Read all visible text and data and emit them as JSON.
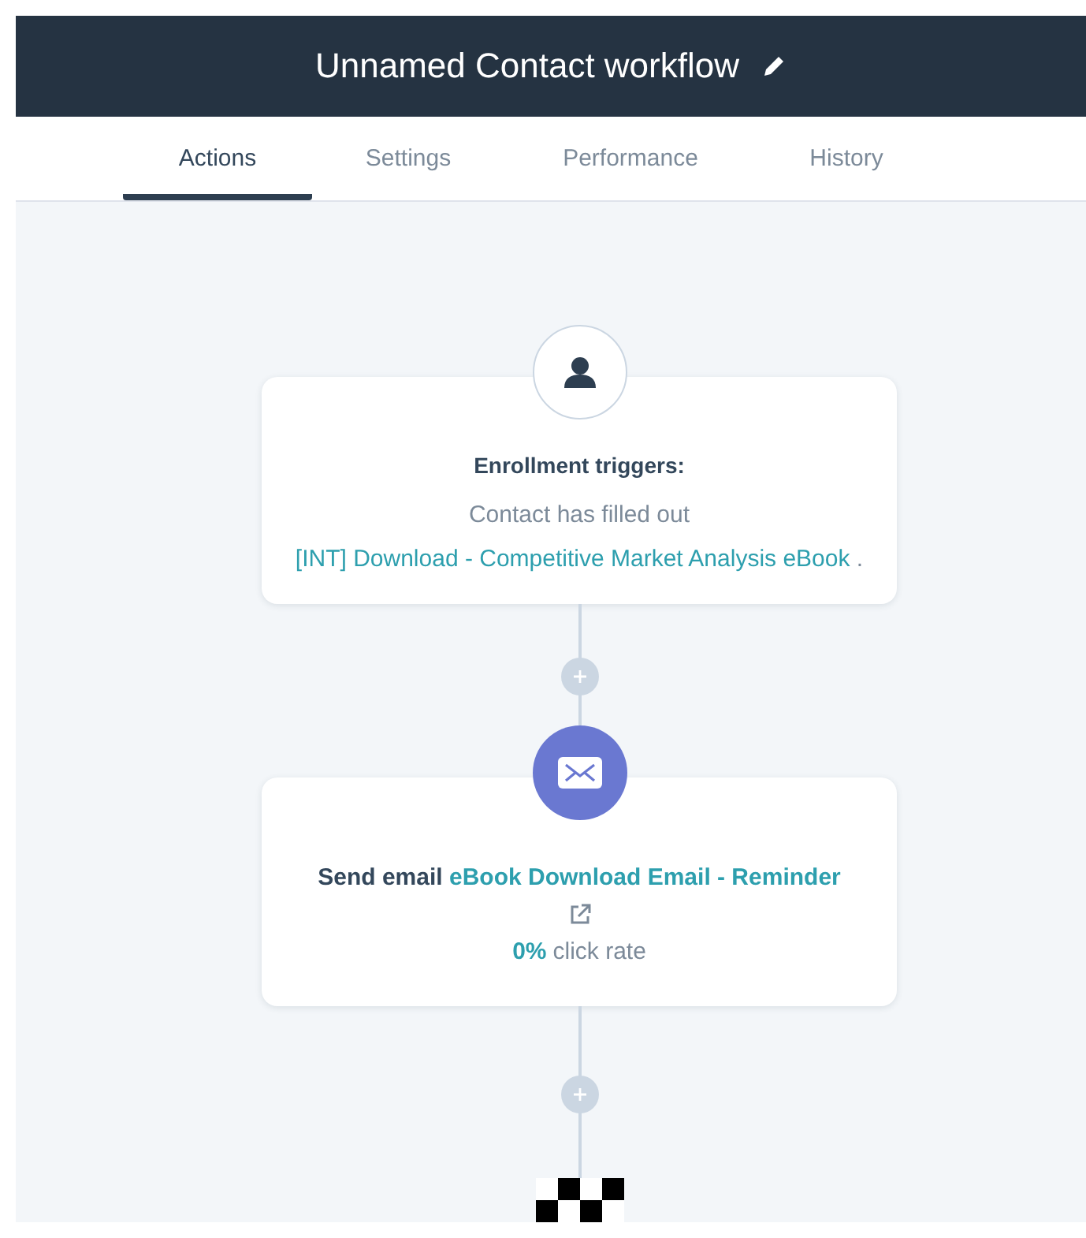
{
  "header": {
    "title": "Unnamed Contact workflow"
  },
  "tabs": [
    {
      "label": "Actions",
      "selected": true
    },
    {
      "label": "Settings",
      "selected": false
    },
    {
      "label": "Performance",
      "selected": false
    },
    {
      "label": "History",
      "selected": false
    }
  ],
  "steps": [
    {
      "kind": "trigger",
      "title": "Enrollment triggers:",
      "text": "Contact has filled out",
      "link": "[INT] Download - Competitive Market Analysis eBook",
      "suffix": "."
    },
    {
      "kind": "email",
      "text": "Send email",
      "link": "eBook Download Email - Reminder",
      "stat_value": "0%",
      "stat_label": "click rate"
    }
  ]
}
